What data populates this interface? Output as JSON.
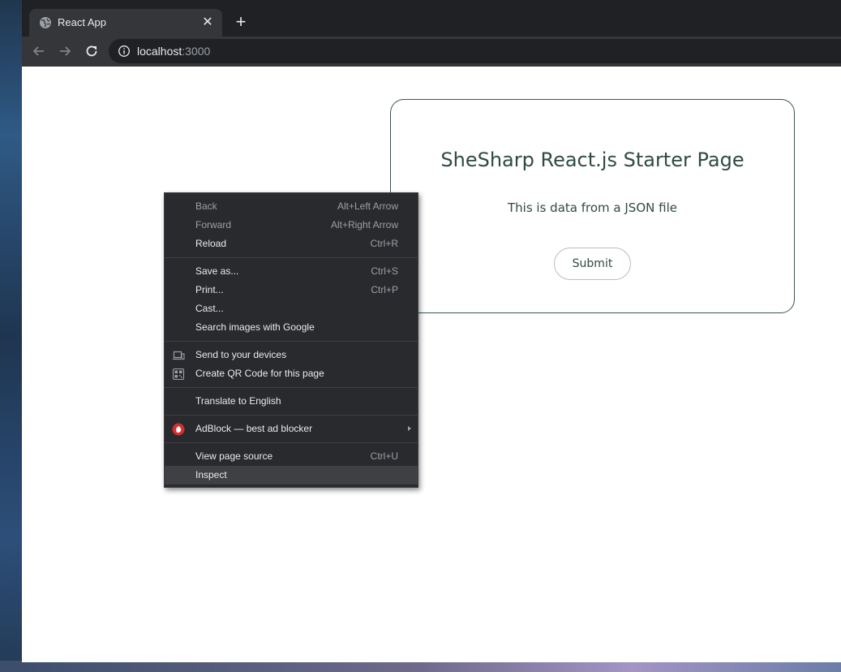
{
  "browser": {
    "tab": {
      "title": "React App",
      "close_symbol": "✕"
    },
    "new_tab_symbol": "+",
    "address": {
      "host": "localhost",
      "port": ":3000"
    }
  },
  "page": {
    "title": "SheSharp React.js Starter Page",
    "text": "This is data from a JSON file",
    "submit_label": "Submit"
  },
  "context_menu": {
    "groups": [
      [
        {
          "label": "Back",
          "shortcut": "Alt+Left Arrow",
          "disabled": true
        },
        {
          "label": "Forward",
          "shortcut": "Alt+Right Arrow",
          "disabled": true
        },
        {
          "label": "Reload",
          "shortcut": "Ctrl+R"
        }
      ],
      [
        {
          "label": "Save as...",
          "shortcut": "Ctrl+S"
        },
        {
          "label": "Print...",
          "shortcut": "Ctrl+P"
        },
        {
          "label": "Cast..."
        },
        {
          "label": "Search images with Google"
        }
      ],
      [
        {
          "label": "Send to your devices",
          "icon": "devices-icon"
        },
        {
          "label": "Create QR Code for this page",
          "icon": "qr-code-icon"
        }
      ],
      [
        {
          "label": "Translate to English"
        }
      ],
      [
        {
          "label": "AdBlock — best ad blocker",
          "icon": "adblock-icon",
          "submenu": true
        }
      ],
      [
        {
          "label": "View page source",
          "shortcut": "Ctrl+U"
        },
        {
          "label": "Inspect",
          "highlighted": true
        }
      ]
    ]
  },
  "colors": {
    "accent_text": "#2f4a45",
    "card_border": "#3d5550",
    "menu_bg": "#292a2d",
    "adblock_red": "#d32f2f"
  }
}
